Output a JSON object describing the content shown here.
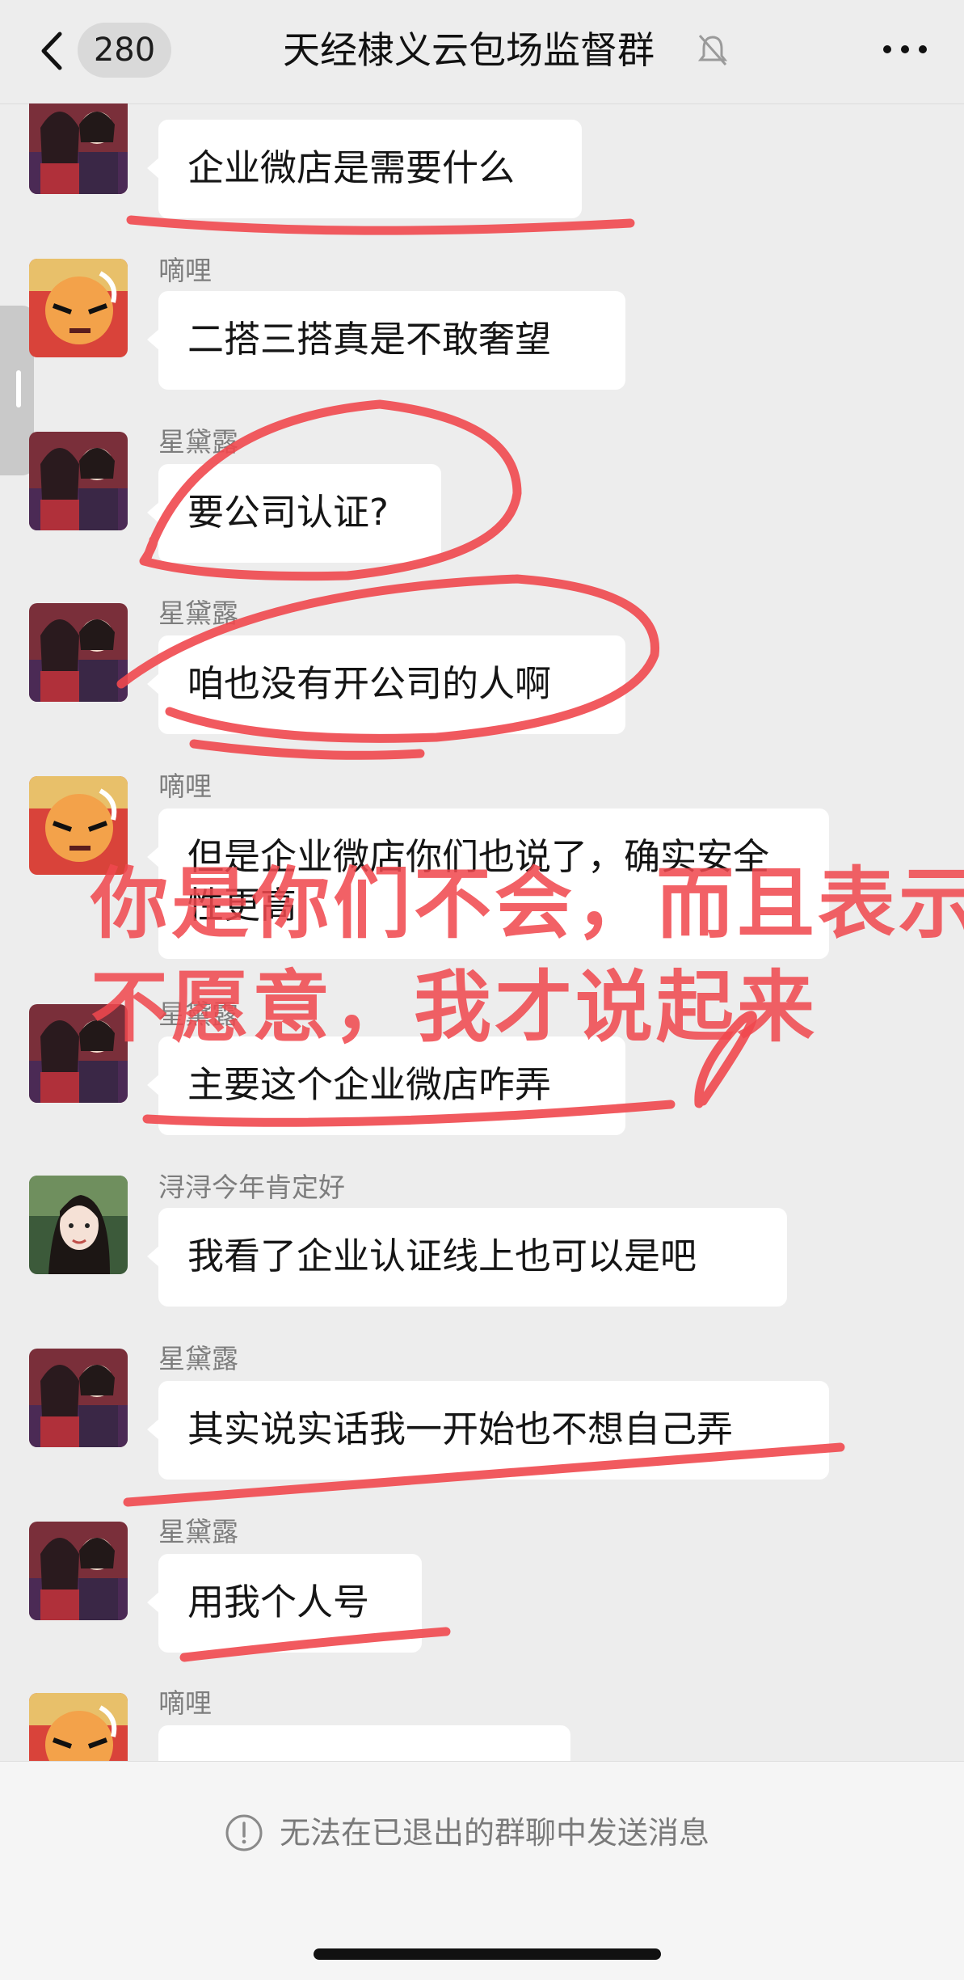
{
  "header": {
    "member_count": "280",
    "title": "天经棣义云包场监督群",
    "back_icon": "chevron-left-icon",
    "mute_icon": "bell-slash-icon",
    "more_icon": "ellipsis-icon"
  },
  "messages": [
    {
      "name": "",
      "text": "企业微店是需要什么",
      "avatar": "couple"
    },
    {
      "name": "嘀哩",
      "text": "二搭三搭真是不敢奢望",
      "avatar": "cartoon"
    },
    {
      "name": "星黛露",
      "text": "要公司认证?",
      "avatar": "couple"
    },
    {
      "name": "星黛露",
      "text": "咱也没有开公司的人啊",
      "avatar": "couple"
    },
    {
      "name": "嘀哩",
      "text": "但是企业微店你们也说了，确实安全性更高",
      "avatar": "cartoon"
    },
    {
      "name": "星黛露",
      "text": "主要这个企业微店咋弄",
      "avatar": "couple"
    },
    {
      "name": "浔浔今年肯定好",
      "text": "我看了企业认证线上也可以是吧",
      "avatar": "girl"
    },
    {
      "name": "星黛露",
      "text": "其实说实话我一开始也不想自己弄",
      "avatar": "couple"
    },
    {
      "name": "星黛露",
      "text": "用我个人号",
      "avatar": "couple"
    },
    {
      "name": "嘀哩",
      "text": "",
      "avatar": "cartoon"
    }
  ],
  "annotation": {
    "line1": "你是你们不会，而且表示",
    "line2": "不愿意，我才说起来",
    "color": "#f0484e"
  },
  "footer": {
    "notice": "无法在已退出的群聊中发送消息",
    "notice_icon": "exclamation-circle-icon"
  }
}
